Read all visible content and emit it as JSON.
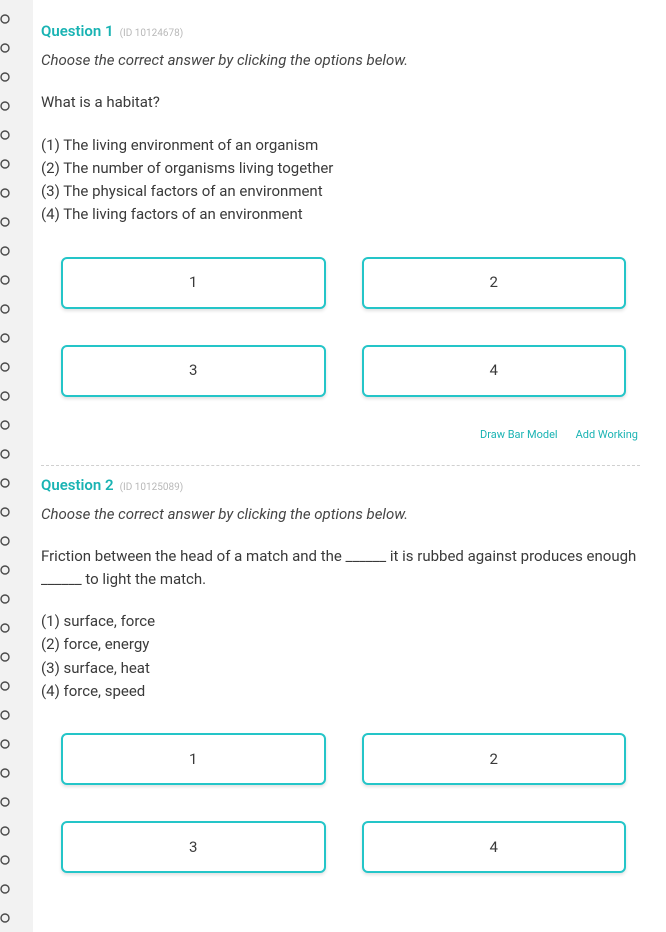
{
  "questions": [
    {
      "title": "Question 1",
      "id_label": "(ID 10124678)",
      "instruction": "Choose the correct answer by clicking the options below.",
      "text": "What is a habitat?",
      "choices": [
        "(1) The living environment of an organism",
        "(2) The number of organisms living together",
        "(3) The physical factors of an environment",
        "(4) The living factors of an environment"
      ],
      "options": [
        "1",
        "2",
        "3",
        "4"
      ],
      "actions": {
        "draw": "Draw Bar Model",
        "add": "Add Working"
      }
    },
    {
      "title": "Question 2",
      "id_label": "(ID 10125089)",
      "instruction": "Choose the correct answer by clicking the options below.",
      "text": "Friction between the head of a match and the ______ it is rubbed against produces enough ______ to light the match.",
      "choices": [
        "(1) surface, force",
        "(2) force, energy",
        "(3) surface, heat",
        "(4) force, speed"
      ],
      "options": [
        "1",
        "2",
        "3",
        "4"
      ],
      "actions": {
        "draw": "Draw Bar Model",
        "add": "Add Working"
      }
    }
  ]
}
